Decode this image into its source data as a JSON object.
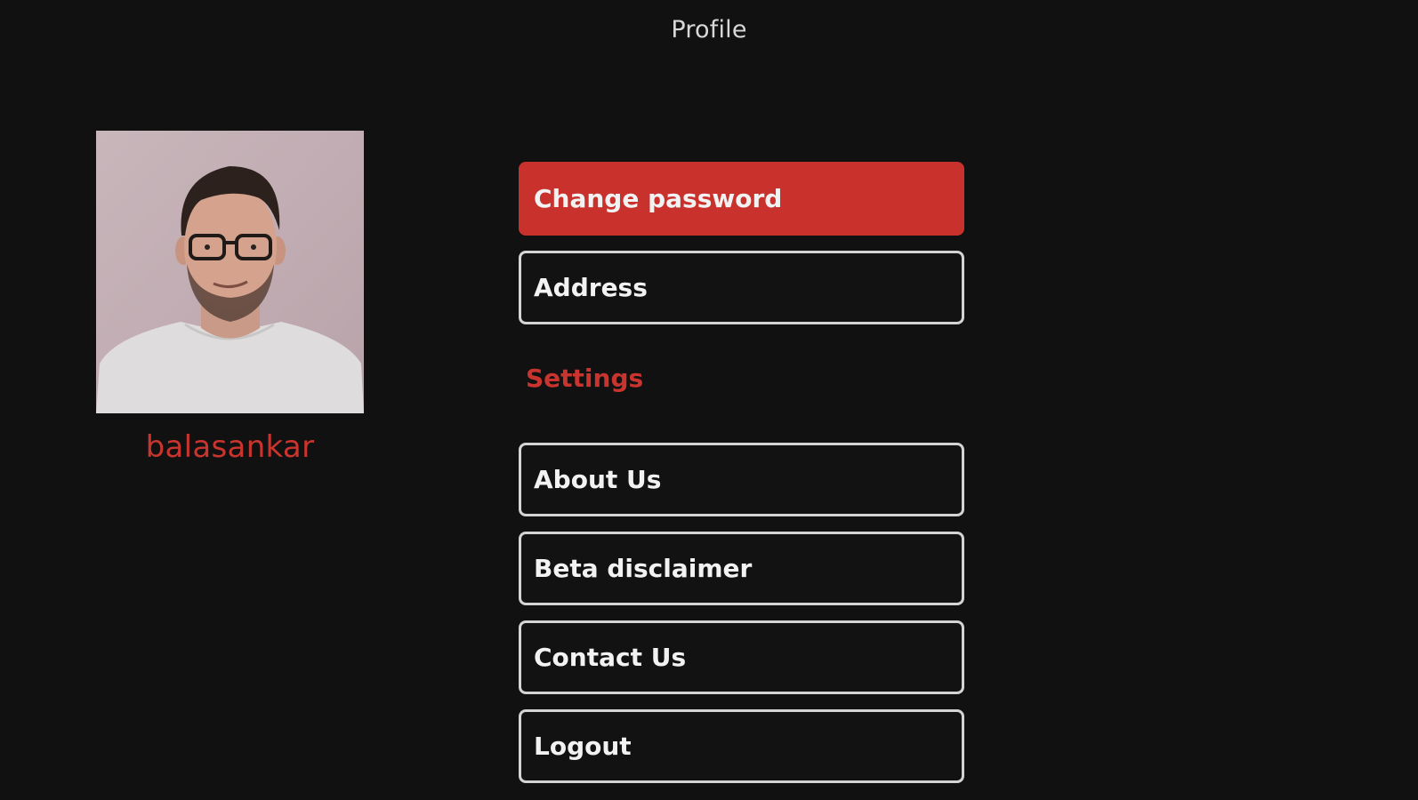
{
  "header": {
    "title": "Profile"
  },
  "profile": {
    "username": "balasankar",
    "avatar_icon": "user-photo"
  },
  "account_menu": [
    {
      "label": "Change password",
      "active": true
    },
    {
      "label": "Address",
      "active": false
    }
  ],
  "settings": {
    "heading": "Settings",
    "items": [
      {
        "label": "About Us"
      },
      {
        "label": "Beta disclaimer"
      },
      {
        "label": "Contact Us"
      },
      {
        "label": "Logout"
      }
    ]
  },
  "colors": {
    "background": "#111111",
    "accent": "#c9312c",
    "button_border": "#d4d4d4",
    "text": "#f2f2f2"
  }
}
